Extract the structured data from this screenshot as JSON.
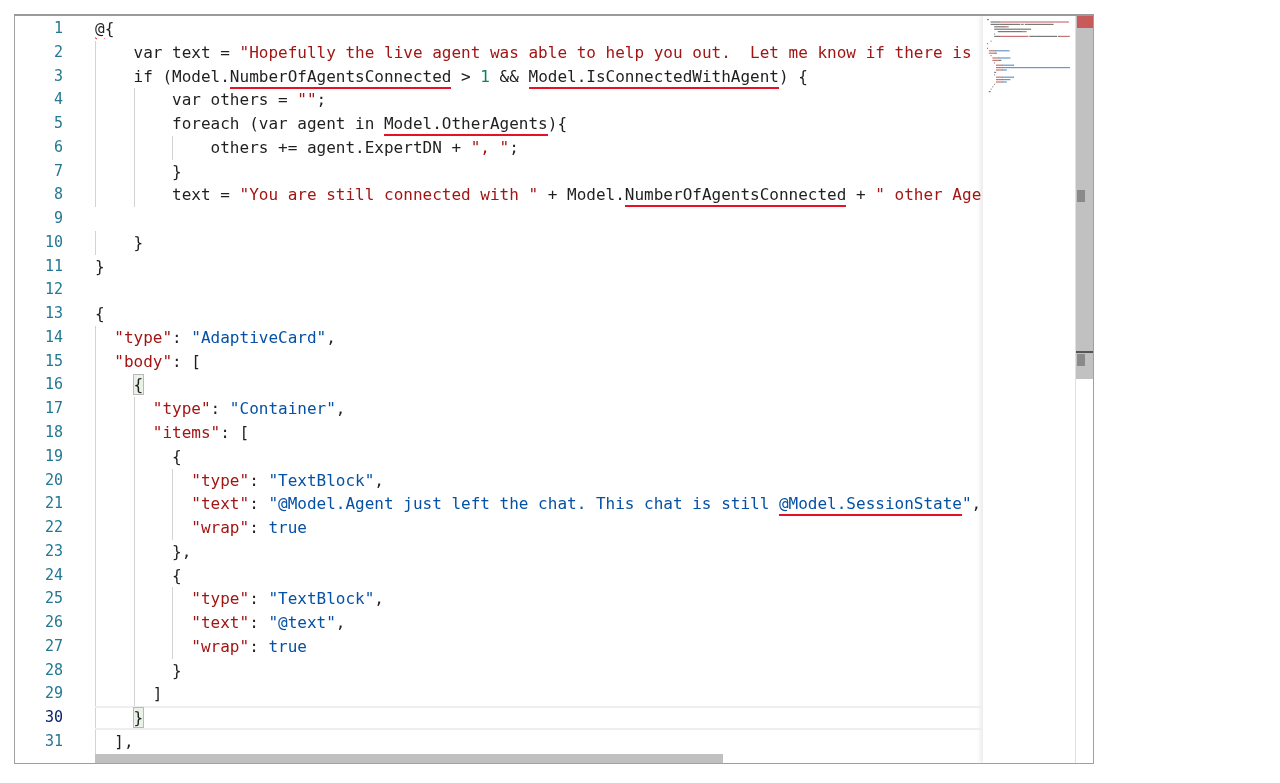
{
  "editor": {
    "selection_at_bottom": true,
    "lines": [
      {
        "number": "1",
        "current": false,
        "tokens": [
          {
            "text": "@",
            "kind": "plain",
            "error": true
          },
          {
            "text": "{",
            "kind": "plain"
          }
        ]
      },
      {
        "number": "2",
        "current": false,
        "tokens": [
          {
            "text": "    var text = ",
            "kind": "plain"
          },
          {
            "text": "\"Hopefully the live agent was able to help you out.  Let me know if there is",
            "kind": "string"
          }
        ]
      },
      {
        "number": "3",
        "current": false,
        "tokens": [
          {
            "text": "    if (Model.",
            "kind": "plain"
          },
          {
            "text": "NumberOfAgentsConnected",
            "kind": "plain",
            "underlined": true
          },
          {
            "text": " > ",
            "kind": "plain"
          },
          {
            "text": "1",
            "kind": "number"
          },
          {
            "text": " && ",
            "kind": "plain"
          },
          {
            "text": "Model.IsConnectedWithAgent",
            "kind": "plain",
            "underlined": true
          },
          {
            "text": ") {",
            "kind": "plain"
          }
        ]
      },
      {
        "number": "4",
        "current": false,
        "tokens": [
          {
            "text": "        var others = ",
            "kind": "plain"
          },
          {
            "text": "\"\"",
            "kind": "string"
          },
          {
            "text": ";",
            "kind": "plain"
          }
        ]
      },
      {
        "number": "5",
        "current": false,
        "tokens": [
          {
            "text": "        foreach (var agent in ",
            "kind": "plain"
          },
          {
            "text": "Model.OtherAgents",
            "kind": "plain",
            "underlined": true
          },
          {
            "text": "){",
            "kind": "plain"
          }
        ]
      },
      {
        "number": "6",
        "current": false,
        "tokens": [
          {
            "text": "            others += agent.ExpertDN + ",
            "kind": "plain"
          },
          {
            "text": "\", \"",
            "kind": "string"
          },
          {
            "text": ";",
            "kind": "plain"
          }
        ]
      },
      {
        "number": "7",
        "current": false,
        "tokens": [
          {
            "text": "        }",
            "kind": "plain"
          }
        ]
      },
      {
        "number": "8",
        "current": false,
        "tokens": [
          {
            "text": "        text = ",
            "kind": "plain"
          },
          {
            "text": "\"You are still connected with \"",
            "kind": "string"
          },
          {
            "text": " + Model.",
            "kind": "plain"
          },
          {
            "text": "NumberOfAgentsConnected",
            "kind": "plain",
            "underlined": true
          },
          {
            "text": " + ",
            "kind": "plain"
          },
          {
            "text": "\" other Age",
            "kind": "string"
          }
        ]
      },
      {
        "number": "9",
        "current": false
      },
      {
        "number": "10",
        "current": false,
        "tokens": [
          {
            "text": "    }",
            "kind": "plain"
          }
        ]
      },
      {
        "number": "11",
        "current": false,
        "tokens": [
          {
            "text": "}",
            "kind": "plain"
          }
        ]
      },
      {
        "number": "12",
        "current": false
      },
      {
        "number": "13",
        "current": false,
        "tokens": [
          {
            "text": "{",
            "kind": "plain"
          }
        ]
      },
      {
        "number": "14",
        "current": false,
        "tokens": [
          {
            "text": "  \"type\"",
            "kind": "key"
          },
          {
            "text": ": ",
            "kind": "plain"
          },
          {
            "text": "\"AdaptiveCard\"",
            "kind": "value"
          },
          {
            "text": ",",
            "kind": "plain"
          }
        ]
      },
      {
        "number": "15",
        "current": false,
        "tokens": [
          {
            "text": "  \"body\"",
            "kind": "key"
          },
          {
            "text": ": [",
            "kind": "plain"
          }
        ]
      },
      {
        "number": "16",
        "current": false,
        "tokens": [
          {
            "text": "    {",
            "kind": "plain",
            "matched": true
          }
        ]
      },
      {
        "number": "17",
        "current": false,
        "tokens": [
          {
            "text": "      \"type\"",
            "kind": "key"
          },
          {
            "text": ": ",
            "kind": "plain"
          },
          {
            "text": "\"Container\"",
            "kind": "value"
          },
          {
            "text": ",",
            "kind": "plain"
          }
        ]
      },
      {
        "number": "18",
        "current": false,
        "tokens": [
          {
            "text": "      \"items\"",
            "kind": "key"
          },
          {
            "text": ": [",
            "kind": "plain"
          }
        ]
      },
      {
        "number": "19",
        "current": false,
        "tokens": [
          {
            "text": "        {",
            "kind": "plain"
          }
        ]
      },
      {
        "number": "20",
        "current": false,
        "tokens": [
          {
            "text": "          \"type\"",
            "kind": "key"
          },
          {
            "text": ": ",
            "kind": "plain"
          },
          {
            "text": "\"TextBlock\"",
            "kind": "value"
          },
          {
            "text": ",",
            "kind": "plain"
          }
        ]
      },
      {
        "number": "21",
        "current": false,
        "tokens": [
          {
            "text": "          \"text\"",
            "kind": "key"
          },
          {
            "text": ": ",
            "kind": "plain"
          },
          {
            "text": "\"@Model.Agent just left the chat. This chat is still ",
            "kind": "value"
          },
          {
            "text": "@Model.SessionState",
            "kind": "value",
            "underlined": true
          },
          {
            "text": "\"",
            "kind": "value"
          },
          {
            "text": ",",
            "kind": "plain"
          }
        ]
      },
      {
        "number": "22",
        "current": false,
        "tokens": [
          {
            "text": "          \"wrap\"",
            "kind": "key"
          },
          {
            "text": ": ",
            "kind": "plain"
          },
          {
            "text": "true",
            "kind": "value"
          }
        ]
      },
      {
        "number": "23",
        "current": false,
        "tokens": [
          {
            "text": "        },",
            "kind": "plain"
          }
        ]
      },
      {
        "number": "24",
        "current": false,
        "tokens": [
          {
            "text": "        {",
            "kind": "plain"
          }
        ]
      },
      {
        "number": "25",
        "current": false,
        "tokens": [
          {
            "text": "          \"type\"",
            "kind": "key"
          },
          {
            "text": ": ",
            "kind": "plain"
          },
          {
            "text": "\"TextBlock\"",
            "kind": "value"
          },
          {
            "text": ",",
            "kind": "plain"
          }
        ]
      },
      {
        "number": "26",
        "current": false,
        "tokens": [
          {
            "text": "          \"text\"",
            "kind": "key"
          },
          {
            "text": ": ",
            "kind": "plain"
          },
          {
            "text": "\"@text\"",
            "kind": "value"
          },
          {
            "text": ",",
            "kind": "plain"
          }
        ]
      },
      {
        "number": "27",
        "current": false,
        "tokens": [
          {
            "text": "          \"wrap\"",
            "kind": "key"
          },
          {
            "text": ": ",
            "kind": "plain"
          },
          {
            "text": "true",
            "kind": "value"
          }
        ]
      },
      {
        "number": "28",
        "current": false,
        "tokens": [
          {
            "text": "        }",
            "kind": "plain"
          }
        ]
      },
      {
        "number": "29",
        "current": false,
        "tokens": [
          {
            "text": "      ]",
            "kind": "plain"
          }
        ]
      },
      {
        "number": "30",
        "current": true,
        "tokens": [
          {
            "text": "    }",
            "kind": "plain",
            "matched": true
          }
        ]
      },
      {
        "number": "31",
        "current": false,
        "tokens": [
          {
            "text": "  ],",
            "kind": "plain"
          }
        ]
      }
    ]
  }
}
